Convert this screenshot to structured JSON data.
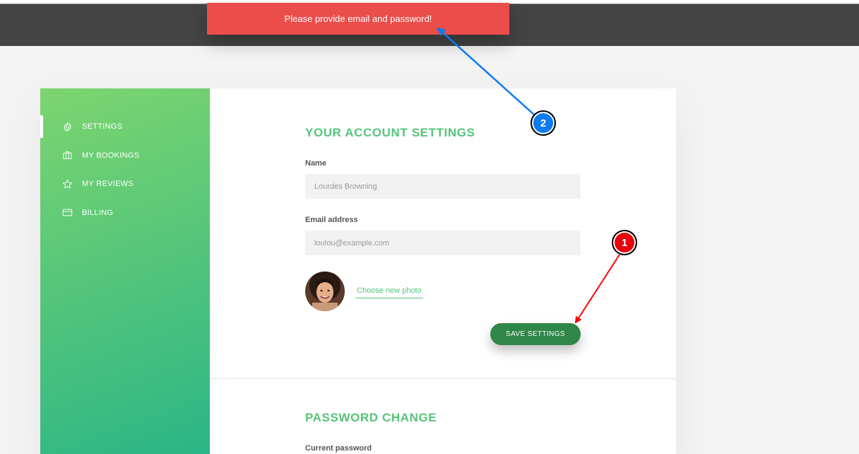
{
  "toast": {
    "message": "Please provide email and password!"
  },
  "sidebar": {
    "items": [
      {
        "label": "SETTINGS",
        "icon": "gear-icon",
        "active": true
      },
      {
        "label": "MY BOOKINGS",
        "icon": "briefcase-icon",
        "active": false
      },
      {
        "label": "MY REVIEWS",
        "icon": "star-icon",
        "active": false
      },
      {
        "label": "BILLING",
        "icon": "credit-card-icon",
        "active": false
      }
    ]
  },
  "account": {
    "title": "YOUR ACCOUNT SETTINGS",
    "name_label": "Name",
    "name_value": "Lourdes Browning",
    "email_label": "Email address",
    "email_value": "loulou@example.com",
    "photo_link": "Choose new photo",
    "save_label": "SAVE SETTINGS"
  },
  "password": {
    "title": "PASSWORD CHANGE",
    "current_label": "Current password"
  },
  "annotations": {
    "step1": "1",
    "step2": "2"
  },
  "colors": {
    "accent": "#55c57a",
    "sidebar_gradient_start": "#7dd56f",
    "sidebar_gradient_end": "#28b487",
    "save_button": "#2e8648",
    "toast": "#eb4d4b",
    "header": "#444444",
    "step1": "#ff0000",
    "step2": "#0a7cf0"
  }
}
